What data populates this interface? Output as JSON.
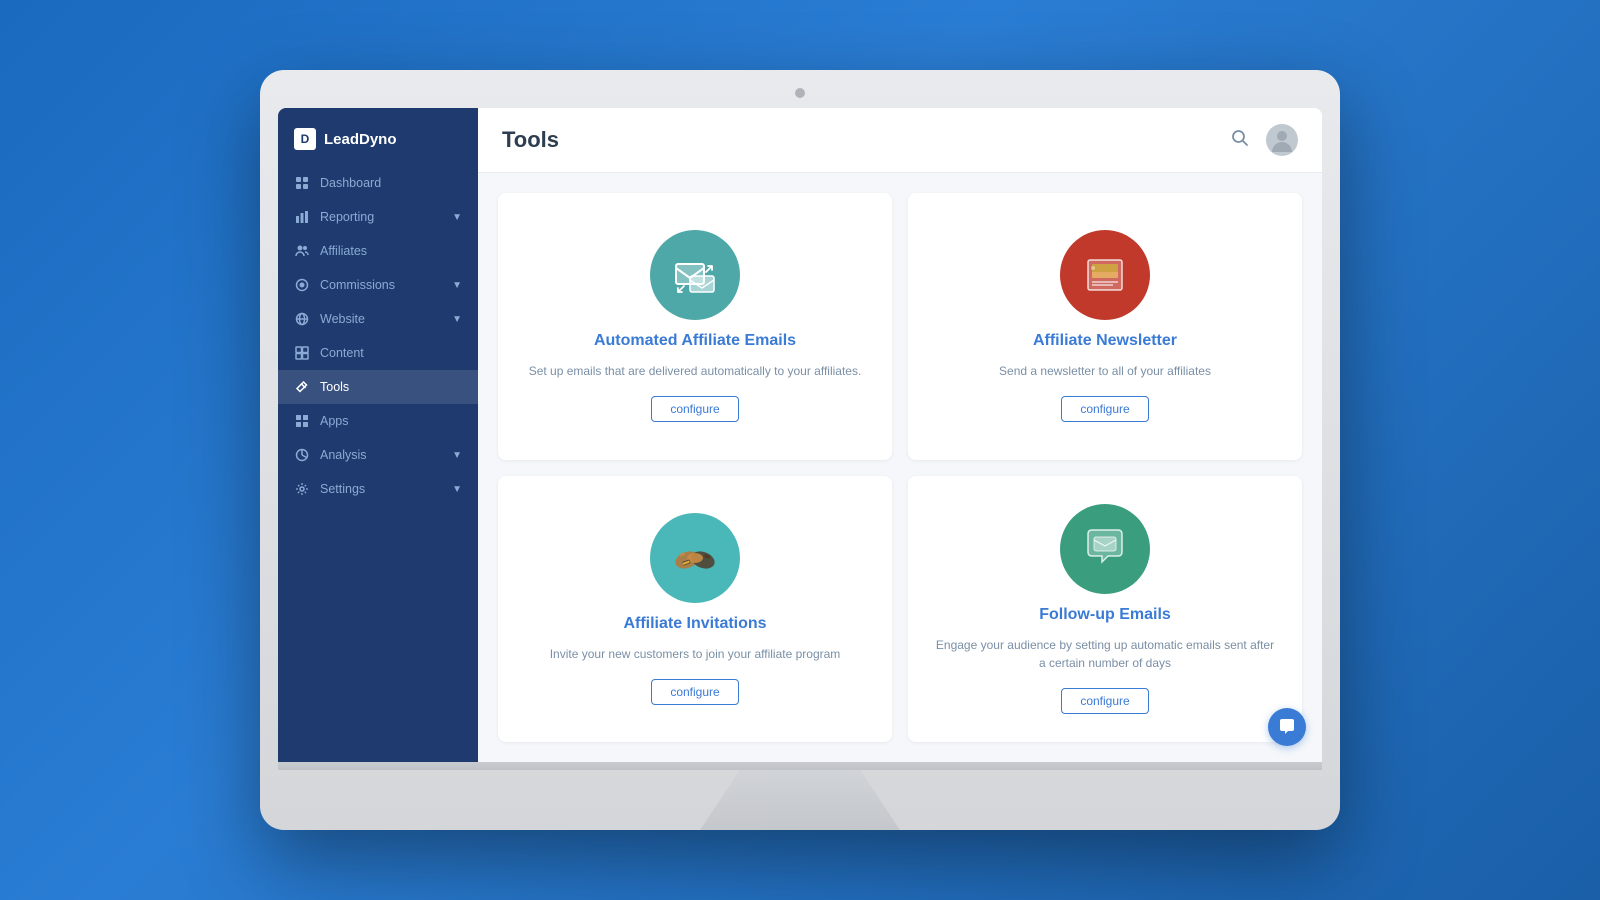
{
  "app": {
    "logo_text": "LeadDyno",
    "page_title": "Tools"
  },
  "sidebar": {
    "items": [
      {
        "id": "dashboard",
        "label": "Dashboard",
        "icon": "dashboard",
        "active": false,
        "has_arrow": false
      },
      {
        "id": "reporting",
        "label": "Reporting",
        "icon": "reporting",
        "active": false,
        "has_arrow": true
      },
      {
        "id": "affiliates",
        "label": "Affiliates",
        "icon": "affiliates",
        "active": false,
        "has_arrow": false
      },
      {
        "id": "commissions",
        "label": "Commissions",
        "icon": "commissions",
        "active": false,
        "has_arrow": true
      },
      {
        "id": "website",
        "label": "Website",
        "icon": "website",
        "active": false,
        "has_arrow": true
      },
      {
        "id": "content",
        "label": "Content",
        "icon": "content",
        "active": false,
        "has_arrow": false
      },
      {
        "id": "tools",
        "label": "Tools",
        "icon": "tools",
        "active": true,
        "has_arrow": false
      },
      {
        "id": "apps",
        "label": "Apps",
        "icon": "apps",
        "active": false,
        "has_arrow": false
      },
      {
        "id": "analysis",
        "label": "Analysis",
        "icon": "analysis",
        "active": false,
        "has_arrow": true
      },
      {
        "id": "settings",
        "label": "Settings",
        "icon": "settings",
        "active": false,
        "has_arrow": true
      }
    ]
  },
  "cards": [
    {
      "id": "automated-emails",
      "title": "Automated Affiliate Emails",
      "description": "Set up emails that are delivered automatically to your affiliates.",
      "icon_color": "#4fa8a8",
      "configure_label": "configure"
    },
    {
      "id": "affiliate-newsletter",
      "title": "Affiliate Newsletter",
      "description": "Send a newsletter to all of your affiliates",
      "icon_color": "#c0392b",
      "configure_label": "configure"
    },
    {
      "id": "affiliate-invitations",
      "title": "Affiliate Invitations",
      "description": "Invite your new customers to join your affiliate program",
      "icon_color": "#4ab8b8",
      "configure_label": "configure"
    },
    {
      "id": "followup-emails",
      "title": "Follow-up Emails",
      "description": "Engage your audience by setting up automatic emails sent after a certain number of days",
      "icon_color": "#3a9e7e",
      "configure_label": "configure"
    }
  ]
}
